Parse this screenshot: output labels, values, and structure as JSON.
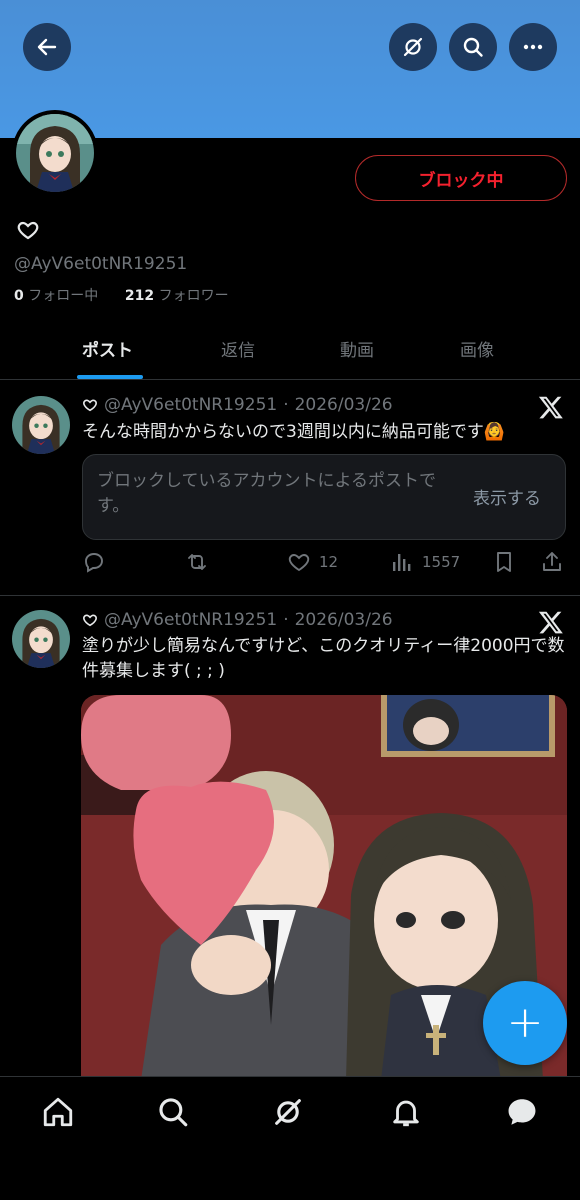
{
  "header": {
    "back_icon": "arrow-left-icon",
    "grok_icon": "grok-icon",
    "search_icon": "search-icon",
    "more_icon": "more-horizontal-icon",
    "banner_color": "#4a98e4"
  },
  "profile": {
    "block_button_label": "ブロック中",
    "handle": "@AyV6et0tNR19251",
    "following_count": "0",
    "following_label": "フォロー中",
    "followers_count": "212",
    "followers_label": "フォロワー"
  },
  "tabs": [
    {
      "label": "ポスト",
      "active": true
    },
    {
      "label": "返信",
      "active": false
    },
    {
      "label": "動画",
      "active": false
    },
    {
      "label": "画像",
      "active": false
    }
  ],
  "posts": [
    {
      "handle": "@AyV6et0tNR19251",
      "date": "2026/03/26",
      "text": "そんな時間かからないので3週間以内に納品可能です🙆",
      "blocked_notice": "ブロックしているアカウントによるポストです。",
      "show_label": "表示する",
      "likes": "12",
      "views": "1557"
    },
    {
      "handle": "@AyV6et0tNR19251",
      "date": "2026/03/26",
      "text": "塗りが少し簡易なんですけど、このクオリティー律2000円で数件募集します( ; ; )"
    }
  ],
  "fab_label": "+",
  "colors": {
    "accent": "#1d9bf0",
    "block_red": "#f4212e"
  }
}
